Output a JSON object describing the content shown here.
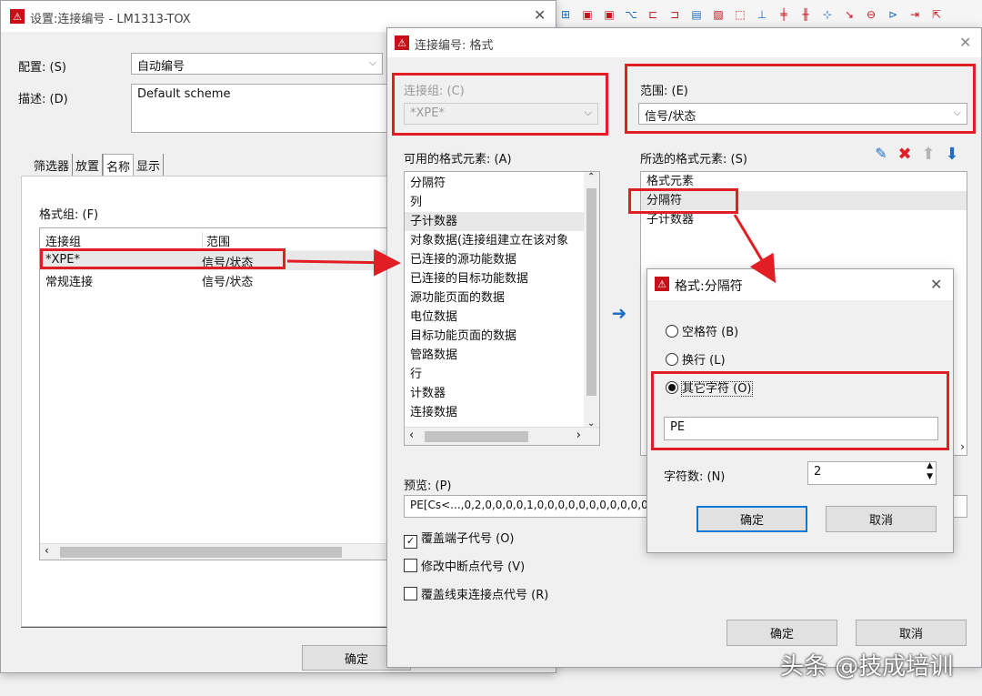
{
  "toolbar": {
    "icons": [
      "grid-icon",
      "box-icon",
      "box-icon",
      "wire-icon",
      "connector-icon",
      "terminal-icon",
      "hatch-icon",
      "hatch-icon",
      "frame-icon",
      "align-icon",
      "junction-icon",
      "junction-icon",
      "junction-icon",
      "wire-icon",
      "wire-icon",
      "wire-icon",
      "wire-icon",
      "cursor-icon"
    ]
  },
  "bg_window": {
    "title": "设置:连接编号 - LM1313-TOX",
    "config_label": "配置: (S)",
    "config_value": "自动编号",
    "desc_label": "描述: (D)",
    "desc_value": "Default scheme",
    "tabs": [
      "筛选器",
      "放置",
      "名称",
      "显示"
    ],
    "format_group_label": "格式组: (F)",
    "table_headers": [
      "连接组",
      "范围"
    ],
    "rows": [
      {
        "group": "*XPE*",
        "scope": "信号/状态"
      },
      {
        "group": "常规连接",
        "scope": "信号/状态"
      }
    ],
    "ok_label": "确定"
  },
  "format_dialog": {
    "title": "连接编号: 格式",
    "conn_group_label": "连接组: (C)",
    "conn_group_value": "*XPE*",
    "scope_label": "范围: (E)",
    "scope_value": "信号/状态",
    "available_label": "可用的格式元素: (A)",
    "available_items": [
      "分隔符",
      "列",
      "子计数器",
      "对象数据(连接组建立在该对象",
      "已连接的源功能数据",
      "已连接的目标功能数据",
      "源功能页面的数据",
      "电位数据",
      "目标功能页面的数据",
      "管路数据",
      "行",
      "计数器",
      "连接数据"
    ],
    "selected_label": "所选的格式元素: (S)",
    "selected_items": [
      "格式元素",
      "分隔符",
      "子计数器"
    ],
    "preview_label": "预览: (P)",
    "preview_value": "PE[Cs<...,0,2,0,0,0,0,1,0,0,0,0,0,0,0,0,0,0,0,0,0,0,0,0,0",
    "checkboxes": [
      {
        "label": "覆盖端子代号 (O)",
        "checked": true
      },
      {
        "label": "修改中断点代号 (V)",
        "checked": false
      },
      {
        "label": "覆盖线束连接点代号 (R)",
        "checked": false
      }
    ],
    "ok_label": "确定",
    "cancel_label": "取消"
  },
  "separator_dialog": {
    "title": "格式:分隔符",
    "options": [
      {
        "label": "空格符 (B)",
        "selected": false
      },
      {
        "label": "换行 (L)",
        "selected": false
      },
      {
        "label": "其它字符 (O)",
        "selected": true
      }
    ],
    "other_char_value": "PE",
    "char_count_label": "字符数: (N)",
    "char_count_value": "2",
    "ok_label": "确定",
    "cancel_label": "取消"
  },
  "watermark": "头条 @技成培训",
  "colors": {
    "highlight": "#e01e24",
    "accent": "#0078d7",
    "logo": "#c8101a"
  }
}
